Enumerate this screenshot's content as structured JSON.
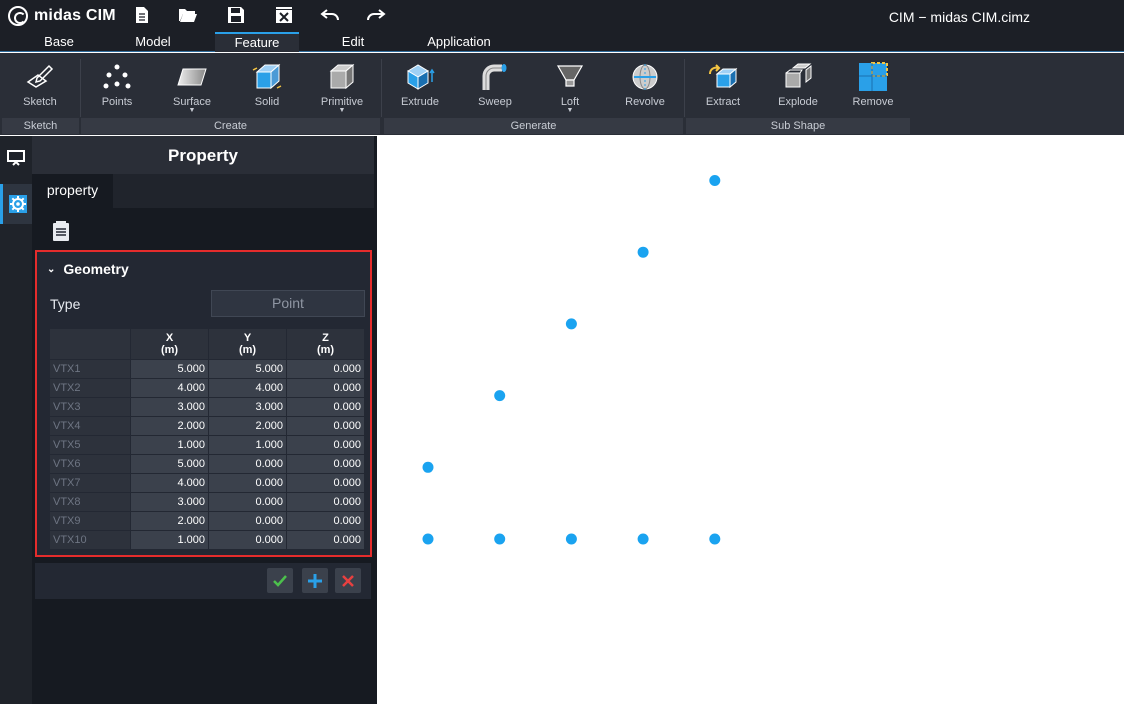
{
  "app": {
    "logo_text": "midas CIM",
    "window_title": "CIM − midas CIM.cimz",
    "quick_access": [
      "file-new-icon",
      "folder-open-icon",
      "save-icon",
      "close-file-icon",
      "undo-icon",
      "redo-icon"
    ]
  },
  "menu": {
    "tabs": [
      {
        "label": "Base"
      },
      {
        "label": "Model"
      },
      {
        "label": "Feature",
        "active": true
      },
      {
        "label": "Edit"
      },
      {
        "label": "Application"
      }
    ]
  },
  "ribbon": {
    "groups": {
      "sketch": "Sketch",
      "create": "Create",
      "generate": "Generate",
      "subshape": "Sub Shape"
    },
    "buttons": {
      "sketch": "Sketch",
      "points": "Points",
      "surface": "Surface",
      "solid": "Solid",
      "primitive": "Primitive",
      "extrude": "Extrude",
      "sweep": "Sweep",
      "loft": "Loft",
      "revolve": "Revolve",
      "extract": "Extract",
      "explode": "Explode",
      "remove": "Remove"
    }
  },
  "panel": {
    "title": "Property",
    "tab": "property",
    "geometry_header": "Geometry",
    "type_label": "Type",
    "type_value": "Point",
    "columns": [
      {
        "name": "X",
        "unit": "(m)"
      },
      {
        "name": "Y",
        "unit": "(m)"
      },
      {
        "name": "Z",
        "unit": "(m)"
      }
    ],
    "rows": [
      {
        "label": "VTX1",
        "x": "5.000",
        "y": "5.000",
        "z": "0.000"
      },
      {
        "label": "VTX2",
        "x": "4.000",
        "y": "4.000",
        "z": "0.000"
      },
      {
        "label": "VTX3",
        "x": "3.000",
        "y": "3.000",
        "z": "0.000"
      },
      {
        "label": "VTX4",
        "x": "2.000",
        "y": "2.000",
        "z": "0.000"
      },
      {
        "label": "VTX5",
        "x": "1.000",
        "y": "1.000",
        "z": "0.000"
      },
      {
        "label": "VTX6",
        "x": "5.000",
        "y": "0.000",
        "z": "0.000"
      },
      {
        "label": "VTX7",
        "x": "4.000",
        "y": "0.000",
        "z": "0.000"
      },
      {
        "label": "VTX8",
        "x": "3.000",
        "y": "0.000",
        "z": "0.000"
      },
      {
        "label": "VTX9",
        "x": "2.000",
        "y": "0.000",
        "z": "0.000"
      },
      {
        "label": "VTX10",
        "x": "1.000",
        "y": "0.000",
        "z": "0.000"
      }
    ]
  },
  "colors": {
    "accent": "#2aa0e8",
    "point": "#1aa3f0",
    "highlight_border": "#e52c2c",
    "confirm": "#4cc04c",
    "add": "#2aa0e8",
    "cancel": "#e84040"
  }
}
